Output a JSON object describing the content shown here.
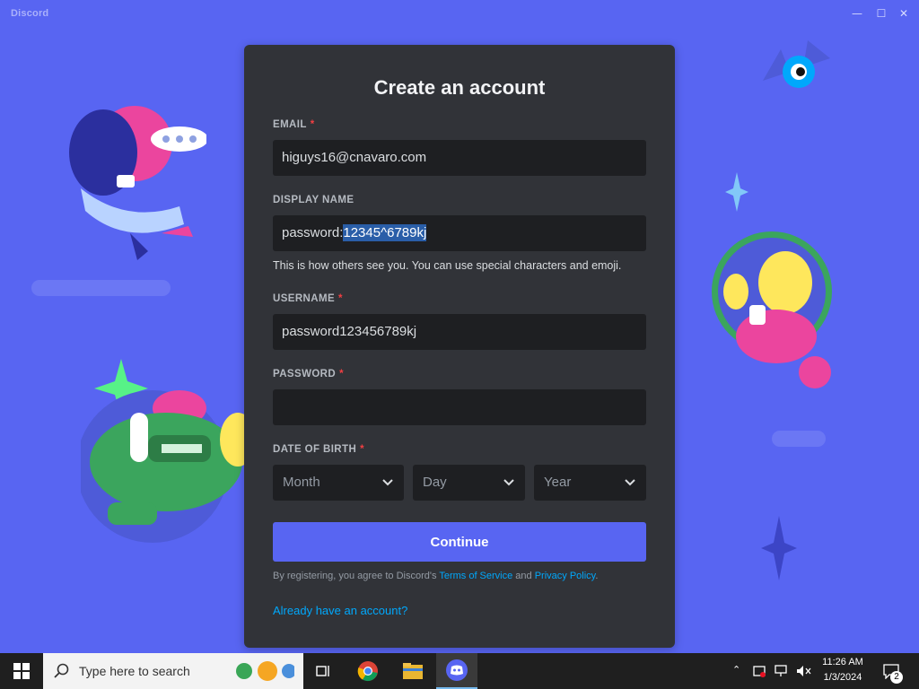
{
  "window": {
    "title": "Discord"
  },
  "form": {
    "heading": "Create an account",
    "email": {
      "label": "EMAIL",
      "value": "higuys16@cnavaro.com"
    },
    "display_name": {
      "label": "DISPLAY NAME",
      "value_prefix": "password:",
      "value_selected": "12345^6789kj",
      "hint": "This is how others see you. You can use special characters and emoji."
    },
    "username": {
      "label": "USERNAME",
      "value": "password123456789kj"
    },
    "password": {
      "label": "PASSWORD",
      "value": ""
    },
    "dob": {
      "label": "DATE OF BIRTH",
      "month": "Month",
      "day": "Day",
      "year": "Year"
    },
    "required_mark": "*",
    "continue_label": "Continue",
    "terms": {
      "prefix": "By registering, you agree to Discord's ",
      "tos": "Terms of Service",
      "and": " and ",
      "privacy": "Privacy Policy",
      "suffix": "."
    },
    "login_link": "Already have an account?"
  },
  "taskbar": {
    "search_placeholder": "Type here to search",
    "time": "11:26 AM",
    "date": "1/3/2024",
    "notification_count": "2"
  },
  "colors": {
    "brand": "#5865f2",
    "card": "#313338",
    "input": "#1e1f22",
    "link": "#00a8fc",
    "required": "#f23f42"
  },
  "icons": [
    "windows-start-icon",
    "search-icon",
    "task-view-icon",
    "chrome-icon",
    "file-explorer-icon",
    "discord-icon",
    "chevron-down-icon",
    "notification-icon"
  ]
}
